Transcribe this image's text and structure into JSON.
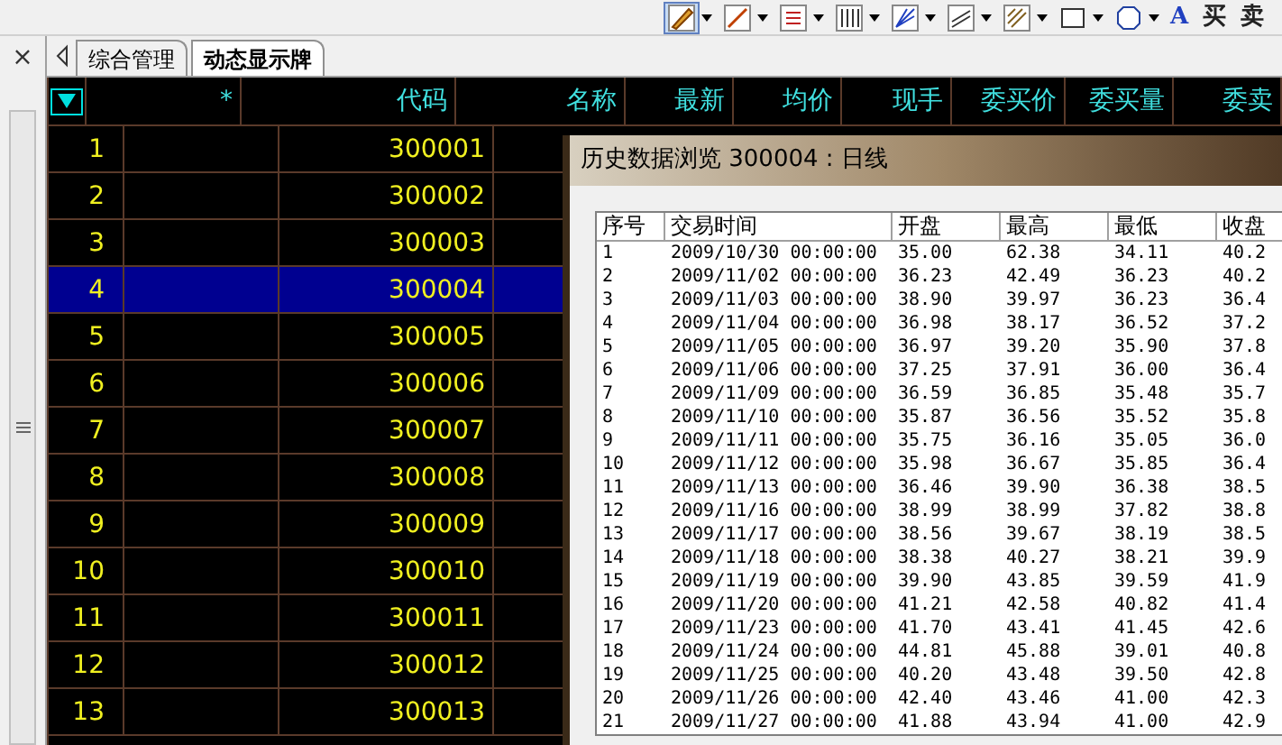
{
  "close_label": "×",
  "toolbar": {
    "tools": [
      {
        "kind": "pen",
        "selected": true
      },
      {
        "kind": "line",
        "selected": false
      },
      {
        "kind": "list",
        "selected": false
      },
      {
        "kind": "bars",
        "selected": false
      },
      {
        "kind": "fan",
        "selected": false
      },
      {
        "kind": "channel",
        "selected": false
      },
      {
        "kind": "hatch",
        "selected": false
      },
      {
        "kind": "rect",
        "selected": false
      },
      {
        "kind": "octagon",
        "selected": false
      }
    ],
    "labels": [
      "A",
      "买",
      "卖"
    ]
  },
  "tabs": [
    {
      "label": "综合管理",
      "selected": false
    },
    {
      "label": "动态显示牌",
      "selected": true
    }
  ],
  "grid": {
    "columns": [
      "*",
      "代码",
      "名称",
      "最新",
      "均价",
      "现手",
      "委买价",
      "委买量",
      "委卖"
    ],
    "rows": [
      {
        "index": "1",
        "code": "300001",
        "selected": false
      },
      {
        "index": "2",
        "code": "300002",
        "selected": false
      },
      {
        "index": "3",
        "code": "300003",
        "selected": false
      },
      {
        "index": "4",
        "code": "300004",
        "selected": true
      },
      {
        "index": "5",
        "code": "300005",
        "selected": false
      },
      {
        "index": "6",
        "code": "300006",
        "selected": false
      },
      {
        "index": "7",
        "code": "300007",
        "selected": false
      },
      {
        "index": "8",
        "code": "300008",
        "selected": false
      },
      {
        "index": "9",
        "code": "300009",
        "selected": false
      },
      {
        "index": "10",
        "code": "300010",
        "selected": false
      },
      {
        "index": "11",
        "code": "300011",
        "selected": false
      },
      {
        "index": "12",
        "code": "300012",
        "selected": false
      },
      {
        "index": "13",
        "code": "300013",
        "selected": false
      }
    ]
  },
  "dialog": {
    "title": "历史数据浏览 300004 : 日线",
    "columns": [
      "序号",
      "交易时间",
      "开盘",
      "最高",
      "最低",
      "收盘"
    ],
    "rows": [
      [
        "1",
        "2009/10/30 00:00:00",
        "35.00",
        "62.38",
        "34.11",
        "40.2"
      ],
      [
        "2",
        "2009/11/02 00:00:00",
        "36.23",
        "42.49",
        "36.23",
        "40.2"
      ],
      [
        "3",
        "2009/11/03 00:00:00",
        "38.90",
        "39.97",
        "36.23",
        "36.4"
      ],
      [
        "4",
        "2009/11/04 00:00:00",
        "36.98",
        "38.17",
        "36.52",
        "37.2"
      ],
      [
        "5",
        "2009/11/05 00:00:00",
        "36.97",
        "39.20",
        "35.90",
        "37.8"
      ],
      [
        "6",
        "2009/11/06 00:00:00",
        "37.25",
        "37.91",
        "36.00",
        "36.4"
      ],
      [
        "7",
        "2009/11/09 00:00:00",
        "36.59",
        "36.85",
        "35.48",
        "35.7"
      ],
      [
        "8",
        "2009/11/10 00:00:00",
        "35.87",
        "36.56",
        "35.52",
        "35.8"
      ],
      [
        "9",
        "2009/11/11 00:00:00",
        "35.75",
        "36.16",
        "35.05",
        "36.0"
      ],
      [
        "10",
        "2009/11/12 00:00:00",
        "35.98",
        "36.67",
        "35.85",
        "36.4"
      ],
      [
        "11",
        "2009/11/13 00:00:00",
        "36.46",
        "39.90",
        "36.38",
        "38.5"
      ],
      [
        "12",
        "2009/11/16 00:00:00",
        "38.99",
        "38.99",
        "37.82",
        "38.8"
      ],
      [
        "13",
        "2009/11/17 00:00:00",
        "38.56",
        "39.67",
        "38.19",
        "38.5"
      ],
      [
        "14",
        "2009/11/18 00:00:00",
        "38.38",
        "40.27",
        "38.21",
        "39.9"
      ],
      [
        "15",
        "2009/11/19 00:00:00",
        "39.90",
        "43.85",
        "39.59",
        "41.9"
      ],
      [
        "16",
        "2009/11/20 00:00:00",
        "41.21",
        "42.58",
        "40.82",
        "41.4"
      ],
      [
        "17",
        "2009/11/23 00:00:00",
        "41.70",
        "43.41",
        "41.45",
        "42.6"
      ],
      [
        "18",
        "2009/11/24 00:00:00",
        "44.81",
        "45.88",
        "39.01",
        "40.8"
      ],
      [
        "19",
        "2009/11/25 00:00:00",
        "40.20",
        "43.48",
        "39.50",
        "42.8"
      ],
      [
        "20",
        "2009/11/26 00:00:00",
        "42.40",
        "43.46",
        "41.00",
        "42.3"
      ],
      [
        "21",
        "2009/11/27 00:00:00",
        "41.88",
        "43.94",
        "41.00",
        "42.9"
      ]
    ]
  }
}
